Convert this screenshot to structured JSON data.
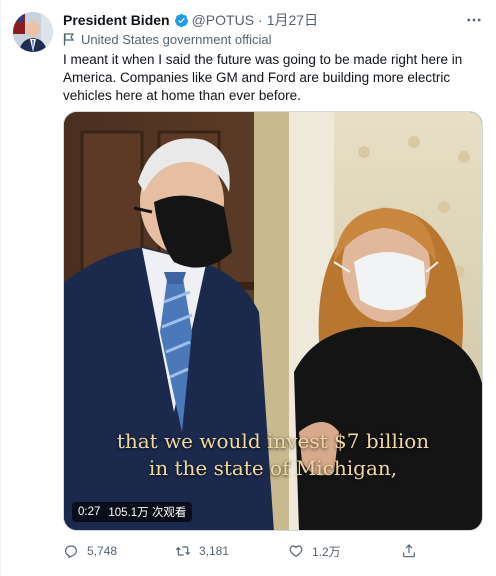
{
  "tweet": {
    "author_name": "President Biden",
    "handle": "@POTUS",
    "separator": "·",
    "timestamp": "1月27日",
    "label": "United States government official",
    "text": "I meant it when I said the future was going to be made right here in America. Companies like GM and Ford are building more electric vehicles here at home than ever before.",
    "icons": [
      "avatar",
      "verified-badge-icon",
      "more-options-icon",
      "flag-icon",
      "reply-icon",
      "retweet-icon",
      "like-icon",
      "share-icon"
    ]
  },
  "video": {
    "caption_line1": "that we would invest $7 billion",
    "caption_line2": "in the state of Michigan,",
    "elapsed": "0:27",
    "views": "105.1万 次观看"
  },
  "actions": {
    "replies": "5,748",
    "retweets": "3,181",
    "likes": "1.2万"
  },
  "colors": {
    "verified": "#1d9bf0",
    "secondary_text": "#536471",
    "caption": "#f0d7a0"
  }
}
